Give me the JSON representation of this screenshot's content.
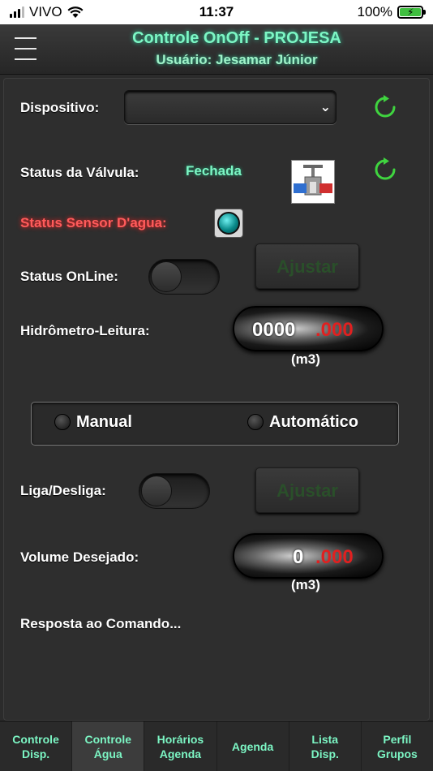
{
  "status_bar": {
    "carrier": "VIVO",
    "time": "11:37",
    "battery": "100%"
  },
  "header": {
    "title": "Controle OnOff - PROJESA",
    "subtitle": "Usuário: Jesamar Júnior"
  },
  "device": {
    "label": "Dispositivo:",
    "selected": ""
  },
  "valve": {
    "label": "Status da Válvula:",
    "value": "Fechada"
  },
  "sensor": {
    "label": "Status Sensor D'agua:"
  },
  "online": {
    "label": "Status OnLine:",
    "toggle_on": false,
    "button": "Ajustar"
  },
  "hydrometer": {
    "label": "Hidrômetro-Leitura:",
    "integer": "0000",
    "decimal": ".000",
    "unit": "(m3)"
  },
  "mode": {
    "manual": "Manual",
    "automatic": "Automático",
    "selected": "none"
  },
  "power": {
    "label": "Liga/Desliga:",
    "toggle_on": false,
    "button": "Ajustar"
  },
  "volume": {
    "label": "Volume Desejado:",
    "integer": "0",
    "decimal": ".000",
    "unit": "(m3)"
  },
  "response": {
    "label": "Resposta ao Comando..."
  },
  "tabs": [
    {
      "line1": "Controle",
      "line2": "Disp.",
      "active": false
    },
    {
      "line1": "Controle",
      "line2": "Água",
      "active": true
    },
    {
      "line1": "Horários",
      "line2": "Agenda",
      "active": false
    },
    {
      "line1": "Agenda",
      "line2": "",
      "active": false
    },
    {
      "line1": "Lista",
      "line2": "Disp.",
      "active": false
    },
    {
      "line1": "Perfil",
      "line2": "Grupos",
      "active": false
    }
  ],
  "colors": {
    "accent": "#7cf6c4",
    "alert": "#ff5b5b",
    "decimal": "#e02020",
    "refresh": "#3fd43f"
  }
}
